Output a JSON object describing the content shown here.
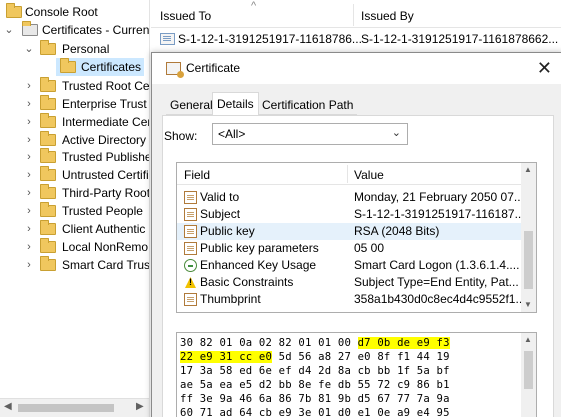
{
  "tree": {
    "items": [
      {
        "label": "Console Root",
        "chev": ""
      },
      {
        "label": "Certificates - Curren",
        "chev": "⌄"
      },
      {
        "label": "Personal",
        "chev": "⌄"
      },
      {
        "label": "Certificates",
        "chev": ""
      },
      {
        "label": "Trusted Root Cer",
        "chev": "›"
      },
      {
        "label": "Enterprise Trust",
        "chev": "›"
      },
      {
        "label": "Intermediate Cer",
        "chev": "›"
      },
      {
        "label": "Active Directory",
        "chev": "›"
      },
      {
        "label": "Trusted Publishe",
        "chev": "›"
      },
      {
        "label": "Untrusted Certifi",
        "chev": "›"
      },
      {
        "label": "Third-Party Root",
        "chev": "›"
      },
      {
        "label": "Trusted People",
        "chev": "›"
      },
      {
        "label": "Client Authentic",
        "chev": "›"
      },
      {
        "label": "Local NonRemo",
        "chev": "›"
      },
      {
        "label": "Smart Card Trust",
        "chev": "›"
      }
    ],
    "scroll_left": "◀",
    "scroll_right": "▶"
  },
  "list": {
    "col_issued_to": "Issued To",
    "col_issued_by": "Issued By",
    "sort_caret": "^",
    "row": {
      "issued_to": "S-1-12-1-3191251917-11618786...",
      "issued_by": "S-1-12-1-3191251917-1161878662..."
    }
  },
  "dialog": {
    "title": "Certificate",
    "close": "✕",
    "tabs": [
      "General",
      "Details",
      "Certification Path"
    ],
    "active_tab": "Details",
    "show_label": "Show:",
    "show_value": "<All>",
    "show_chevron": "⌄",
    "field_header": "Field",
    "value_header": "Value",
    "fields": [
      {
        "name": "Valid to",
        "value": "Monday, 21 February 2050 07...",
        "icon": "doc"
      },
      {
        "name": "Subject",
        "value": "S-1-12-1-3191251917-116187...",
        "icon": "doc"
      },
      {
        "name": "Public key",
        "value": "RSA (2048 Bits)",
        "icon": "doc"
      },
      {
        "name": "Public key parameters",
        "value": "05 00",
        "icon": "doc"
      },
      {
        "name": "Enhanced Key Usage",
        "value": "Smart Card Logon (1.3.6.1.4....",
        "icon": "ext"
      },
      {
        "name": "Basic Constraints",
        "value": "Subject Type=End Entity, Pat...",
        "icon": "warn"
      },
      {
        "name": "Thumbprint",
        "value": "358a1b430d0c8ec4d4c9552f1...",
        "icon": "doc"
      }
    ],
    "selected_field": "Public key",
    "hex": {
      "line1_plain": "30 82 01 0a 02 82 01 01 00 ",
      "line1_highlight": "d7 0b de e9 f3",
      "line2_highlight": "22 e9 31 cc e0",
      "line2_plain": " 5d 56 a8 27 e0 8f f1 44 19",
      "lines": [
        "17 3a 58 ed 6e ef d4 2d 8a cb bb 1f 5a bf",
        "ae 5a ea e5 d2 bb 8e fe db 55 72 c9 86 b1",
        "ff 3e 9a 46 6a 86 7b 81 9b d5 67 77 7a 9a",
        "60 71 ad 64 cb e9 3e 01 d0 e1 0e a9 e4 95"
      ],
      "highlight_color": "#ffff00"
    }
  },
  "colors": {
    "selection": "#cce8ff",
    "row_selected": "#e5f1fb",
    "folder": "#f0c75e"
  }
}
